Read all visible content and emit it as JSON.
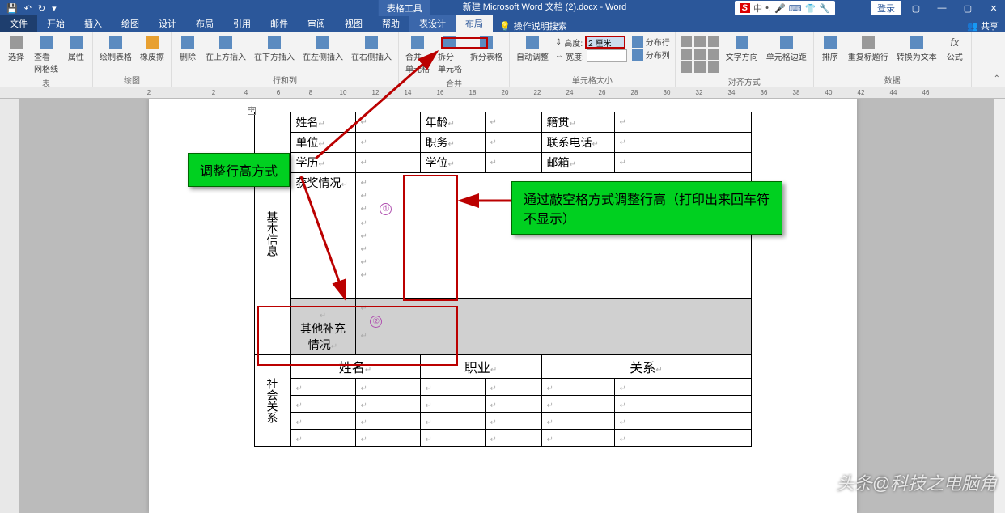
{
  "title_bar": {
    "tools_context": "表格工具",
    "doc_title": "新建 Microsoft Word 文档 (2).docx - Word",
    "login": "登录",
    "ime_s": "S",
    "ime_zh": "中"
  },
  "menu": {
    "file": "文件",
    "tabs": [
      "开始",
      "插入",
      "绘图",
      "设计",
      "布局",
      "引用",
      "邮件",
      "审阅",
      "视图",
      "帮助"
    ],
    "context_tabs": [
      "表设计",
      "布局"
    ],
    "tell_me": "操作说明搜索",
    "share": "共享"
  },
  "ribbon": {
    "groups": {
      "table": {
        "label": "表",
        "select": "选择",
        "view_grid": "查看\n网格线",
        "properties": "属性"
      },
      "draw": {
        "label": "绘图",
        "draw_table": "绘制表格",
        "eraser": "橡皮擦"
      },
      "delete": {
        "label": "",
        "delete": "删除"
      },
      "rows_cols": {
        "label": "行和列",
        "above": "在上方插入",
        "below": "在下方插入",
        "left": "在左侧插入",
        "right": "在右侧插入"
      },
      "merge": {
        "label": "合并",
        "merge_cells": "合并\n单元格",
        "split_cells": "拆分\n单元格",
        "split_table": "拆分表格"
      },
      "autofit": {
        "label": "",
        "autofit": "自动调整"
      },
      "cell_size": {
        "label": "单元格大小",
        "height_lbl": "高度:",
        "height_val": "2 厘米",
        "width_lbl": "宽度:",
        "width_val": "",
        "dist_rows": "分布行",
        "dist_cols": "分布列"
      },
      "alignment": {
        "label": "对齐方式",
        "text_dir": "文字方向",
        "cell_margin": "单元格边距"
      },
      "data": {
        "label": "数据",
        "sort": "排序",
        "repeat_hdr": "重复标题行",
        "to_text": "转换为文本",
        "formula": "公式"
      }
    }
  },
  "doc": {
    "section1_label": "基本信息",
    "row1": [
      "姓名",
      "年龄",
      "籍贯"
    ],
    "row2": [
      "单位",
      "职务",
      "联系电话"
    ],
    "row3": [
      "学历",
      "学位",
      "邮箱"
    ],
    "awards": "获奖情况",
    "supplement": "其他补充情况",
    "section2_label": "社会关系",
    "hdr": [
      "姓名",
      "职业",
      "关系"
    ]
  },
  "annotations": {
    "left_box": "调整行高方式",
    "right_box": "通过敲空格方式调整行高（打印出来回车符不显示）",
    "num1": "①",
    "num2": "②"
  },
  "ruler_nums": [
    "2",
    "",
    "2",
    "4",
    "6",
    "8",
    "10",
    "12",
    "14",
    "16",
    "18",
    "20",
    "22",
    "24",
    "26",
    "28",
    "30",
    "32",
    "34",
    "36",
    "38",
    "40",
    "42",
    "44",
    "46"
  ],
  "watermark": "头条@科技之电脑角"
}
